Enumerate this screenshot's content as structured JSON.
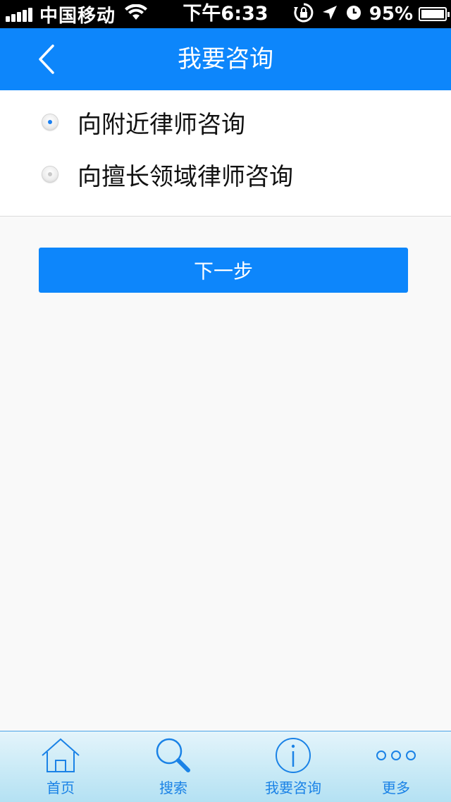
{
  "status_bar": {
    "carrier": "中国移动",
    "time": "下午6:33",
    "battery": "95%",
    "battery_level": 0.95,
    "icons": [
      "signal-icon",
      "wifi-icon",
      "rotation-lock-icon",
      "location-icon",
      "alarm-icon",
      "battery-icon"
    ]
  },
  "nav": {
    "title": "我要咨询",
    "back_icon": "chevron-left-icon"
  },
  "options": [
    {
      "label": "向附近律师咨询",
      "selected": true
    },
    {
      "label": "向擅长领域律师咨询",
      "selected": false
    }
  ],
  "next_button": {
    "label": "下一步"
  },
  "tabs": [
    {
      "label": "首页",
      "icon": "home-icon"
    },
    {
      "label": "搜索",
      "icon": "search-icon"
    },
    {
      "label": "我要咨询",
      "icon": "info-icon"
    },
    {
      "label": "更多",
      "icon": "more-icon"
    }
  ],
  "colors": {
    "accent": "#0d86fb",
    "tab_label": "#1a82e6",
    "background": "#f9f9f9"
  }
}
